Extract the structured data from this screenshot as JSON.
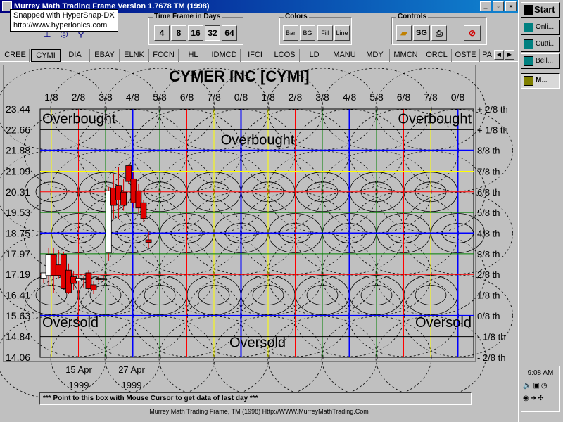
{
  "window": {
    "title": "Murrey Math Trading Frame Version 1.7678  TM (1998)",
    "minimize": "_",
    "maximize": "▫",
    "close": "×"
  },
  "tooltip": {
    "line1": "Snapped with HyperSnap-DX",
    "line2": "http://www.hyperionics.com"
  },
  "timeframe": {
    "label": "Time Frame in Days",
    "buttons": [
      "4",
      "8",
      "16",
      "32",
      "64"
    ],
    "selected": "32"
  },
  "colors": {
    "label": "Colors",
    "buttons": [
      "Bar",
      "BG",
      "Fill",
      "Line"
    ]
  },
  "controls": {
    "label": "Controls",
    "sg_label": "SG"
  },
  "tabs": {
    "items": [
      "CREE",
      "CYMI",
      "DIA",
      "EBAY",
      "ELNK",
      "FCCN",
      "HL",
      "IDMCD",
      "IFCI",
      "LCOS",
      "LD",
      "MANU",
      "MDY",
      "MMCN",
      "ORCL",
      "OSTE",
      "PA"
    ],
    "selected": "CYMI"
  },
  "chart_data": {
    "type": "candlestick",
    "title": "CYMER INC [CYMI]",
    "top_fractions": [
      "1/8",
      "2/8",
      "3/8",
      "4/8",
      "5/8",
      "6/8",
      "7/8",
      "0/8",
      "1/8",
      "2/8",
      "3/8",
      "4/8",
      "5/8",
      "6/8",
      "7/8",
      "0/8"
    ],
    "price_levels": [
      23.44,
      22.66,
      21.88,
      21.09,
      20.31,
      19.53,
      18.75,
      17.97,
      17.19,
      16.41,
      15.63,
      14.84,
      14.06
    ],
    "level_labels": [
      "+ 2/8 th",
      "+ 1/8 th",
      "8/8 th",
      "7/8 th",
      "6/8 th",
      "5/8 th",
      "4/8 th",
      "3/8 th",
      "2/8 th",
      "1/8 th",
      "0/8 th",
      "- 1/8 th",
      "- 2/8 th"
    ],
    "annotations": {
      "overbought_left": "Overbought",
      "overbought_center": "Overbought",
      "overbought_right": "Overbought",
      "oversold_left": "Oversold",
      "oversold_center": "Oversold",
      "oversold_right": "Oversold"
    },
    "x_labels": [
      {
        "date": "15 Apr",
        "year": "1999"
      },
      {
        "date": "27 Apr",
        "year": "1999"
      }
    ],
    "candles": [
      {
        "o": 17.05,
        "h": 17.25,
        "l": 16.85,
        "c": 17.25
      },
      {
        "o": 17.15,
        "h": 18.2,
        "l": 16.75,
        "c": 17.95
      },
      {
        "o": 17.95,
        "h": 18.2,
        "l": 16.5,
        "c": 17.15
      },
      {
        "o": 17.55,
        "h": 18.1,
        "l": 17.05,
        "c": 17.15
      },
      {
        "o": 17.95,
        "h": 18.05,
        "l": 16.75,
        "c": 16.65
      },
      {
        "o": 17.35,
        "h": 17.6,
        "l": 16.45,
        "c": 16.5
      },
      {
        "o": 17.1,
        "h": 17.3,
        "l": 16.6,
        "c": 16.85
      },
      {
        "o": 16.95,
        "h": 17.15,
        "l": 16.55,
        "c": 17.05
      },
      {
        "o": 17.0,
        "h": 17.1,
        "l": 16.7,
        "c": 17.05
      },
      {
        "o": 17.25,
        "h": 17.35,
        "l": 16.6,
        "c": 16.65
      },
      {
        "o": 16.8,
        "h": 16.95,
        "l": 16.45,
        "c": 16.6
      },
      {
        "o": 17.05,
        "h": 17.15,
        "l": 16.9,
        "c": 17.0
      },
      {
        "o": 17.05,
        "h": 17.15,
        "l": 16.95,
        "c": 17.05
      },
      {
        "o": 18.0,
        "h": 20.5,
        "l": 17.7,
        "c": 20.35
      },
      {
        "o": 20.45,
        "h": 21.0,
        "l": 19.3,
        "c": 19.8
      },
      {
        "o": 20.55,
        "h": 21.25,
        "l": 19.3,
        "c": 20.0
      },
      {
        "o": 20.3,
        "h": 20.8,
        "l": 19.6,
        "c": 19.8
      },
      {
        "o": 21.3,
        "h": 21.35,
        "l": 20.6,
        "c": 20.7
      },
      {
        "o": 20.8,
        "h": 21.05,
        "l": 19.7,
        "c": 19.9
      },
      {
        "o": 20.35,
        "h": 20.6,
        "l": 19.5,
        "c": 19.7
      },
      {
        "o": 19.9,
        "h": 20.0,
        "l": 19.2,
        "c": 19.3
      },
      {
        "o": 18.5,
        "h": 18.8,
        "l": 18.2,
        "c": 18.4
      }
    ],
    "colors": {
      "background": "#c0c0c0",
      "up_candle": "#ffffff",
      "down_candle": "#e00000",
      "major_grid": "#0000ff",
      "grid_red": "#ff0000",
      "grid_yellow": "#ffff00",
      "grid_green": "#008000"
    }
  },
  "status_text": "*** Point to this box with Mouse Cursor to get data of last day ***",
  "footer": "Murrey Math Trading Frame, TM (1998)  Http://WWW.MurreyMathTrading.Com",
  "taskbar": {
    "start": "Start",
    "items": [
      "Onli...",
      "Cutti...",
      "Bell...",
      "M..."
    ],
    "clock": "9:08 AM"
  }
}
